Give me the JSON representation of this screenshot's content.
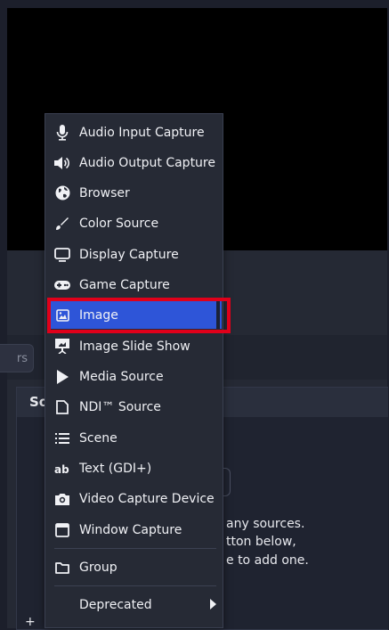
{
  "filter_placeholder": "rs",
  "dock_title": "So",
  "empty_hint": {
    "line1": "any sources.",
    "line2": "tton below,",
    "line3": "e to add one."
  },
  "add_menu": {
    "items": [
      {
        "label": "Audio Input Capture",
        "icon": "microphone-icon"
      },
      {
        "label": "Audio Output Capture",
        "icon": "speaker-icon"
      },
      {
        "label": "Browser",
        "icon": "globe-icon"
      },
      {
        "label": "Color Source",
        "icon": "paintbrush-icon"
      },
      {
        "label": "Display Capture",
        "icon": "monitor-icon"
      },
      {
        "label": "Game Capture",
        "icon": "gamepad-icon"
      },
      {
        "label": "Image",
        "icon": "image-icon",
        "highlighted": true
      },
      {
        "label": "Image Slide Show",
        "icon": "slideshow-icon"
      },
      {
        "label": "Media Source",
        "icon": "play-icon"
      },
      {
        "label": "NDI™ Source",
        "icon": "ndi-icon"
      },
      {
        "label": "Scene",
        "icon": "list-icon"
      },
      {
        "label": "Text (GDI+)",
        "icon": "text-icon"
      },
      {
        "label": "Video Capture Device",
        "icon": "camera-icon"
      },
      {
        "label": "Window Capture",
        "icon": "window-icon"
      }
    ],
    "group_label": "Group",
    "deprecated_label": "Deprecated"
  },
  "colors": {
    "highlight": "#2e55d8",
    "selection_outline": "#e0001a",
    "menu_bg": "#262a35"
  }
}
